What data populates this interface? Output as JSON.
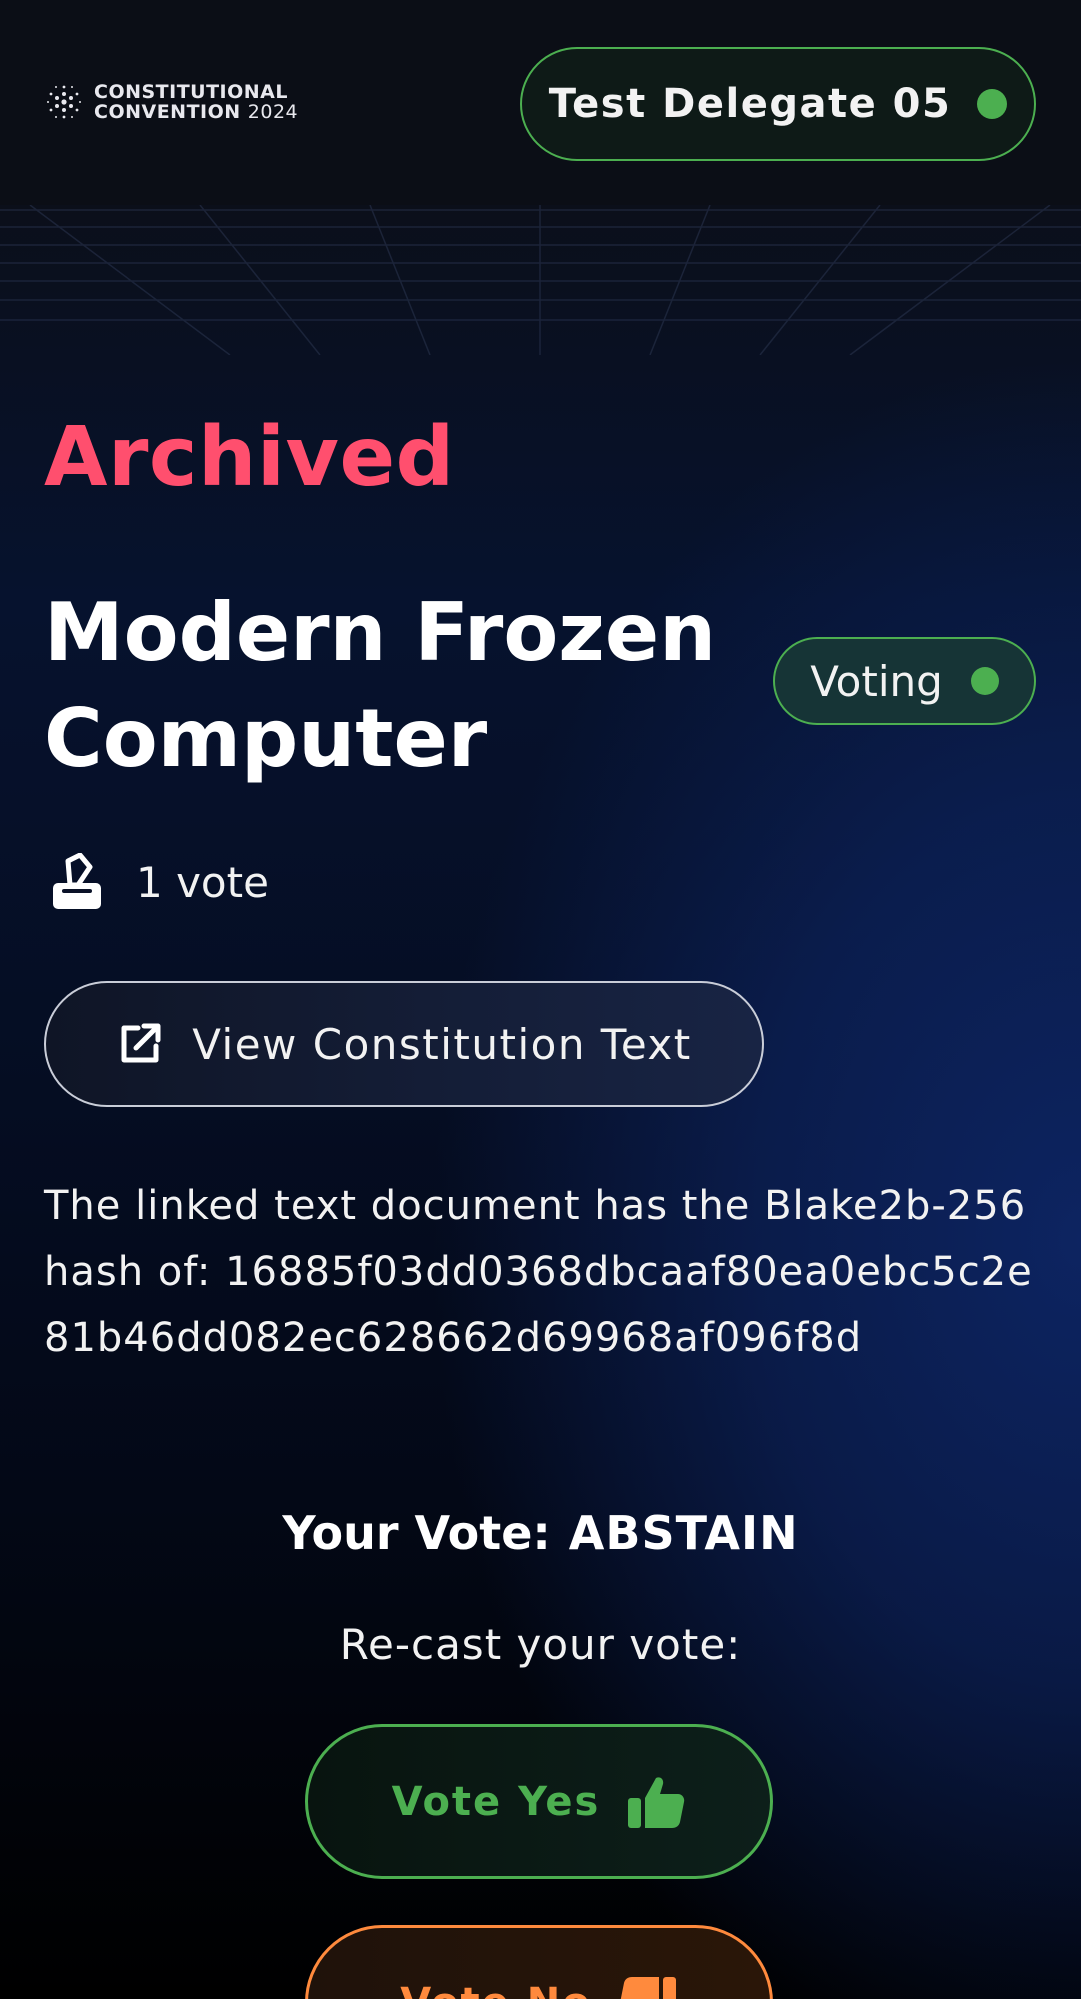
{
  "header": {
    "logo_line1": "CONSTITUTIONAL",
    "logo_line2": "CONVENTION",
    "logo_year": "2024",
    "delegate_name": "Test Delegate 05",
    "delegate_status_color": "#4caf50"
  },
  "proposal": {
    "status": "Archived",
    "status_color": "#ff4f6e",
    "title": "Modern Frozen Computer",
    "phase_badge": "Voting",
    "vote_count": "1 vote",
    "view_button_label": "View Constitution Text",
    "hash_intro": "The linked text document has the Blake2b-256 hash of:",
    "hash_value": "16885f03dd0368dbcaaf80ea0ebc5c2e81b46dd082ec628662d69968af096f8d"
  },
  "voting": {
    "your_vote_label": "Your Vote:",
    "your_vote_value": "ABSTAIN",
    "recast_label": "Re-cast your vote:",
    "yes_label": "Vote Yes",
    "no_label": "Vote No",
    "yes_color": "#4caf50",
    "no_color": "#ff8a3d"
  },
  "icons": {
    "logo": "cardano-star-icon",
    "votes": "ballot-box-icon",
    "view": "external-link-icon",
    "yes": "thumbs-up-icon",
    "no": "thumbs-down-icon"
  }
}
